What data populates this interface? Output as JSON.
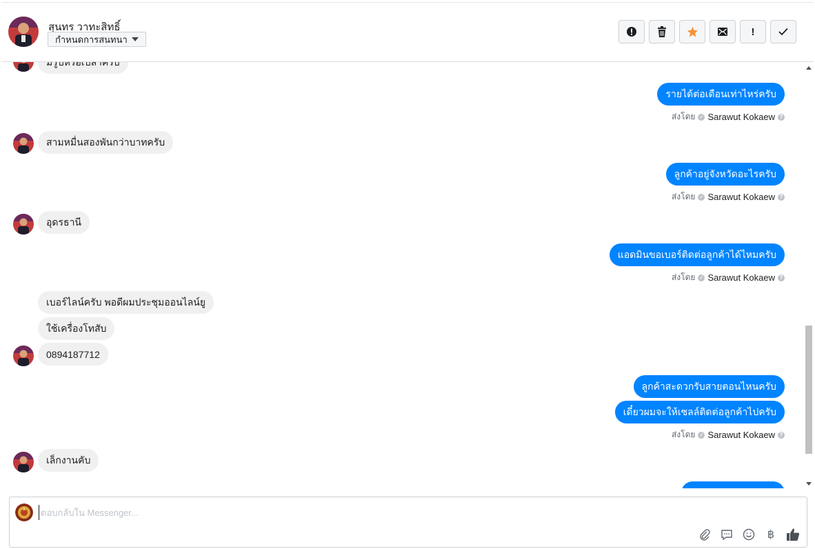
{
  "header": {
    "contact_name": "สุนทร วาทะสิทธิ์",
    "assign_label": "กำหนดการสนทนา",
    "actions": [
      {
        "name": "spam-button",
        "icon": "exclamation-circle-icon"
      },
      {
        "name": "delete-button",
        "icon": "trash-icon"
      },
      {
        "name": "star-button",
        "icon": "star-icon",
        "color": "#f7923b"
      },
      {
        "name": "mark-unread-button",
        "icon": "envelope-icon"
      },
      {
        "name": "follow-up-button",
        "icon": "exclamation-icon",
        "label": "!"
      },
      {
        "name": "mark-done-button",
        "icon": "check-icon"
      }
    ]
  },
  "messages": {
    "top_partial": "มีรูปหรือเปล่าครับ",
    "m1_out": "รายได้ต่อเดือนเท่าไหร่ครับ",
    "m2_in": "สามหมื่นสองพันกว่าบาทครับ",
    "m3_out": "ลูกค้าอยู่จังหวัดอะไรครับ",
    "m4_in": "อุดรธานี",
    "m5_out": "แอดมินขอเบอร์ติดต่อลูกค้าได้ไหมครับ",
    "m6_in": "เบอร์ไลน์ครับ พอดีผมประชุมออนไลน์ยู",
    "m7_in": "ใช้เครื่องโทสับ",
    "m8_in": "0894187712",
    "m9_out": "ลูกค้าสะดวกรับสายตอนไหนครับ",
    "m10_out": "เดี๋ยวผมจะให้เซลล์ติดต่อลูกค้าไปครับ",
    "m11_in": "เล็กงานคับ",
    "sent_by_label": "ส่งโดย",
    "sender_name": "Sarawut Kokaew"
  },
  "composer": {
    "placeholder": "ตอบกลับใน Messenger...",
    "value": "",
    "tools": [
      "attach-icon",
      "saved-replies-icon",
      "emoji-icon",
      "baht-payment-icon",
      "thumbs-up-icon"
    ]
  },
  "colors": {
    "outgoing_bubble": "#0084ff",
    "incoming_bubble": "#f0f0f0",
    "star": "#f7923b"
  }
}
